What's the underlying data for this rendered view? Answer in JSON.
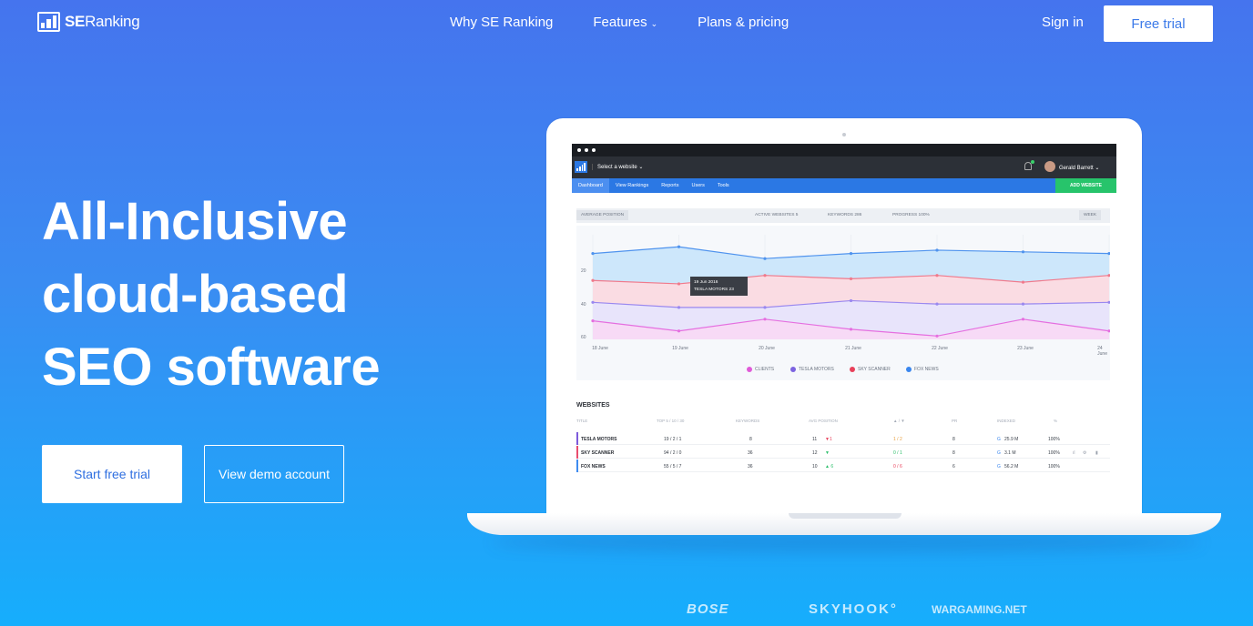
{
  "nav": {
    "logo_se": "SE",
    "logo_ranking": "Ranking",
    "links": [
      "Why SE Ranking",
      "Features",
      "Plans & pricing"
    ],
    "sign_in": "Sign in",
    "cta": "Free trial"
  },
  "hero": {
    "title_lines": [
      "All-Inclusive",
      "cloud-based",
      "SEO software"
    ],
    "primary_button": "Start free trial",
    "secondary_button": "View demo account"
  },
  "screen": {
    "site_select": "Select a website",
    "user_name": "Gerald Barrett",
    "menu": [
      "Dashboard",
      "View Rankings",
      "Reports",
      "Users",
      "Tools"
    ],
    "add_website": "ADD WEBSITE",
    "filter": {
      "average_position": "AVERAGE POSITION",
      "active_websites": "ACTIVE WEBSITES 5",
      "keywords": "KEYWORDS 286",
      "progress": "PROGRESS 100%",
      "period": "WEEK"
    },
    "tooltip": {
      "date": "19 Jun 2016",
      "value": "TESLA MOTORS 23"
    },
    "websites_title": "WEBSITES",
    "table_headers": [
      "TITLE",
      "TOP 5 / 10 / 30",
      "KEYWORDS",
      "AVG POSITION",
      "▲ / ▼",
      "PR",
      "INDEXED",
      "%"
    ],
    "rows": [
      {
        "name": "TESLA MOTORS",
        "top": "19 / 2 / 1",
        "keywords": "8",
        "avg": "11",
        "change": "▼1",
        "updown": "1 / 2",
        "pr": "8",
        "indexed": "25.9 M",
        "pct": "100%",
        "color": "#7d5bdb"
      },
      {
        "name": "SKY SCANNER",
        "top": "94 / 2 / 0",
        "keywords": "36",
        "avg": "12",
        "change": "▼",
        "updown": "0 / 1",
        "pr": "8",
        "indexed": "3.1 M",
        "pct": "100%",
        "color": "#e84d6e"
      },
      {
        "name": "FOX NEWS",
        "top": "55 / 5 / 7",
        "keywords": "36",
        "avg": "10",
        "change": "▲ 6",
        "updown": "0 / 6",
        "pr": "6",
        "indexed": "56.2 M",
        "pct": "100%",
        "color": "#3e8bf0"
      }
    ]
  },
  "chart_data": {
    "type": "area",
    "categories": [
      "18 June",
      "19 June",
      "20 June",
      "21 June",
      "22 June",
      "23 June",
      "24 June"
    ],
    "y_ticks": [
      "20",
      "40",
      "60"
    ],
    "ylim": [
      0,
      60
    ],
    "y_reversed": true,
    "series": [
      {
        "name": "FOX NEWS",
        "color": "#4f93ee",
        "values": [
          9,
          5,
          12,
          9,
          7,
          8,
          9
        ]
      },
      {
        "name": "SKY SCANNER",
        "color": "#f07a8c",
        "values": [
          25,
          27,
          22,
          24,
          22,
          26,
          22
        ]
      },
      {
        "name": "TESLA MOTORS",
        "color": "#9a88ef",
        "values": [
          38,
          41,
          41,
          37,
          39,
          39,
          38
        ]
      },
      {
        "name": "CLIENTS",
        "color": "#e56fe0",
        "values": [
          49,
          55,
          48,
          54,
          58,
          48,
          55
        ]
      }
    ],
    "legend": [
      "CLIENTS",
      "TESLA MOTORS",
      "SKY SCANNER",
      "FOX NEWS"
    ],
    "legend_colors": [
      "#e05ad8",
      "#7c63e0",
      "#e8405a",
      "#3a86ee"
    ],
    "grid": true
  },
  "clients": [
    "BOSE",
    "SKYHOOK°",
    "WARGAMING.NET"
  ]
}
